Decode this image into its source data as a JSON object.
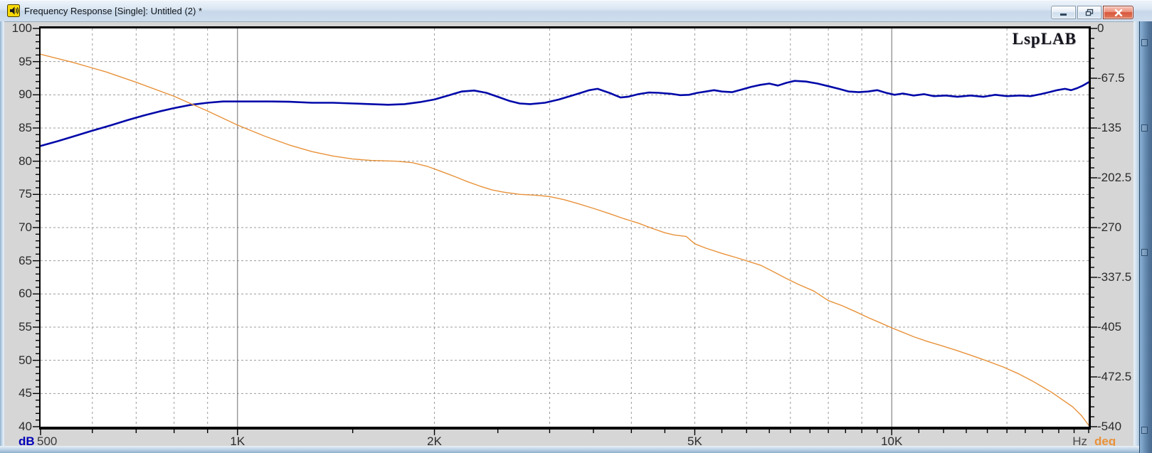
{
  "window": {
    "title": "Frequency Response [Single]: Untitled (2) *",
    "icon": "speaker-icon",
    "buttons": {
      "minimize": "Minimize",
      "restore": "Restore",
      "close": "Close"
    }
  },
  "chart": {
    "brand": "LspLAB",
    "left_axis_unit": "dB",
    "right_axis_unit": "deg",
    "x_axis_unit": "Hz",
    "x_start_label": "500",
    "colors": {
      "spl": "#0008a8",
      "phase": "#e8923a",
      "grid": "#9b9b9b",
      "decade": "#6e6e6e",
      "frame": "#000000"
    }
  },
  "chart_data": {
    "type": "line",
    "title": "Frequency Response",
    "x_axis": {
      "label": "Hz",
      "scale": "log",
      "min": 500,
      "max": 20000,
      "tick_labels": [
        "500",
        "1K",
        "2K",
        "5K",
        "10K"
      ],
      "tick_values": [
        500,
        1000,
        2000,
        5000,
        10000
      ],
      "grid_dashed": [
        600,
        700,
        800,
        900,
        2000,
        3000,
        4000,
        5000,
        6000,
        7000,
        8000,
        9000,
        15000
      ],
      "grid_solid": [
        1000,
        10000
      ],
      "minor_ticks": [
        600,
        700,
        800,
        900,
        1000,
        1500,
        2000,
        2500,
        3000,
        3500,
        4000,
        4500,
        5000,
        5500,
        6000,
        6500,
        7000,
        7500,
        8000,
        8500,
        9000,
        9500,
        10000,
        11000,
        12000,
        13000,
        14000,
        15000,
        16000,
        17000,
        18000,
        19000,
        20000
      ]
    },
    "y_left": {
      "label": "dB",
      "min": 40,
      "max": 100,
      "major_step": 5,
      "minor_step": 1,
      "ticks": [
        100,
        95,
        90,
        85,
        80,
        75,
        70,
        65,
        60,
        55,
        50,
        45,
        40
      ]
    },
    "y_right": {
      "label": "deg",
      "min": -540,
      "max": 0,
      "major_step": 67.5,
      "minor_step": 13.5,
      "tick_labels": [
        "0",
        "-67.5",
        "-135",
        "-202.5",
        "-270",
        "-337.5",
        "-405",
        "-472.5",
        "-540"
      ]
    },
    "grid": true,
    "legend": "none",
    "series": [
      {
        "name": "SPL",
        "unit": "dB",
        "axis": "left",
        "color": "#0008a8",
        "width": 2.6,
        "points": [
          [
            500,
            82.3
          ],
          [
            530,
            83.0
          ],
          [
            560,
            83.7
          ],
          [
            600,
            84.6
          ],
          [
            640,
            85.4
          ],
          [
            680,
            86.2
          ],
          [
            720,
            86.9
          ],
          [
            760,
            87.5
          ],
          [
            800,
            88.0
          ],
          [
            850,
            88.5
          ],
          [
            900,
            88.8
          ],
          [
            950,
            89.0
          ],
          [
            1000,
            89.0
          ],
          [
            1060,
            89.0
          ],
          [
            1120,
            89.0
          ],
          [
            1200,
            88.95
          ],
          [
            1300,
            88.8
          ],
          [
            1400,
            88.8
          ],
          [
            1500,
            88.7
          ],
          [
            1600,
            88.6
          ],
          [
            1700,
            88.5
          ],
          [
            1800,
            88.6
          ],
          [
            1900,
            88.9
          ],
          [
            2000,
            89.3
          ],
          [
            2100,
            89.9
          ],
          [
            2200,
            90.5
          ],
          [
            2300,
            90.65
          ],
          [
            2400,
            90.3
          ],
          [
            2500,
            89.7
          ],
          [
            2600,
            89.1
          ],
          [
            2700,
            88.7
          ],
          [
            2800,
            88.6
          ],
          [
            2950,
            88.8
          ],
          [
            3100,
            89.3
          ],
          [
            3300,
            90.1
          ],
          [
            3450,
            90.7
          ],
          [
            3550,
            90.9
          ],
          [
            3700,
            90.3
          ],
          [
            3850,
            89.6
          ],
          [
            3950,
            89.7
          ],
          [
            4100,
            90.1
          ],
          [
            4250,
            90.35
          ],
          [
            4400,
            90.3
          ],
          [
            4600,
            90.15
          ],
          [
            4750,
            89.95
          ],
          [
            4900,
            90.0
          ],
          [
            5050,
            90.3
          ],
          [
            5200,
            90.5
          ],
          [
            5350,
            90.7
          ],
          [
            5500,
            90.5
          ],
          [
            5700,
            90.4
          ],
          [
            5900,
            90.8
          ],
          [
            6100,
            91.2
          ],
          [
            6300,
            91.5
          ],
          [
            6500,
            91.7
          ],
          [
            6700,
            91.4
          ],
          [
            6900,
            91.8
          ],
          [
            7100,
            92.1
          ],
          [
            7400,
            92.0
          ],
          [
            7700,
            91.7
          ],
          [
            8000,
            91.3
          ],
          [
            8300,
            90.9
          ],
          [
            8600,
            90.5
          ],
          [
            8900,
            90.4
          ],
          [
            9200,
            90.5
          ],
          [
            9500,
            90.7
          ],
          [
            9800,
            90.3
          ],
          [
            10100,
            90.0
          ],
          [
            10400,
            90.2
          ],
          [
            10800,
            89.9
          ],
          [
            11200,
            90.1
          ],
          [
            11600,
            89.8
          ],
          [
            12100,
            89.9
          ],
          [
            12600,
            89.7
          ],
          [
            13200,
            89.9
          ],
          [
            13800,
            89.7
          ],
          [
            14400,
            90.0
          ],
          [
            15000,
            89.8
          ],
          [
            15700,
            89.9
          ],
          [
            16300,
            89.8
          ],
          [
            16900,
            90.1
          ],
          [
            17400,
            90.4
          ],
          [
            17900,
            90.7
          ],
          [
            18400,
            90.9
          ],
          [
            18800,
            90.7
          ],
          [
            19200,
            91.0
          ],
          [
            19600,
            91.4
          ],
          [
            20000,
            91.9
          ]
        ]
      },
      {
        "name": "Phase",
        "unit": "deg",
        "axis": "right",
        "color": "#e8923a",
        "width": 1.4,
        "points": [
          [
            500,
            -35
          ],
          [
            560,
            -46
          ],
          [
            630,
            -59
          ],
          [
            700,
            -73
          ],
          [
            800,
            -92
          ],
          [
            900,
            -112
          ],
          [
            1000,
            -131
          ],
          [
            1100,
            -146
          ],
          [
            1200,
            -158
          ],
          [
            1300,
            -167
          ],
          [
            1400,
            -173
          ],
          [
            1500,
            -177
          ],
          [
            1600,
            -179
          ],
          [
            1750,
            -180
          ],
          [
            1850,
            -182
          ],
          [
            1950,
            -187
          ],
          [
            2050,
            -194
          ],
          [
            2150,
            -201
          ],
          [
            2250,
            -208
          ],
          [
            2350,
            -214
          ],
          [
            2450,
            -219
          ],
          [
            2550,
            -222
          ],
          [
            2700,
            -225
          ],
          [
            2850,
            -226
          ],
          [
            3000,
            -228
          ],
          [
            3150,
            -232
          ],
          [
            3300,
            -237
          ],
          [
            3500,
            -244
          ],
          [
            3700,
            -251
          ],
          [
            3900,
            -258
          ],
          [
            4100,
            -264
          ],
          [
            4300,
            -271
          ],
          [
            4500,
            -277
          ],
          [
            4650,
            -280
          ],
          [
            4850,
            -282
          ],
          [
            5000,
            -292
          ],
          [
            5200,
            -298
          ],
          [
            5500,
            -305
          ],
          [
            5800,
            -311
          ],
          [
            6000,
            -315
          ],
          [
            6300,
            -321
          ],
          [
            6600,
            -330
          ],
          [
            6900,
            -339
          ],
          [
            7200,
            -347
          ],
          [
            7600,
            -356
          ],
          [
            8000,
            -369
          ],
          [
            8400,
            -376
          ],
          [
            8800,
            -384
          ],
          [
            9200,
            -392
          ],
          [
            9600,
            -399
          ],
          [
            10000,
            -406
          ],
          [
            10400,
            -412
          ],
          [
            10800,
            -418
          ],
          [
            11300,
            -424
          ],
          [
            11900,
            -430
          ],
          [
            12500,
            -436
          ],
          [
            13200,
            -443
          ],
          [
            14000,
            -451
          ],
          [
            14800,
            -459
          ],
          [
            15600,
            -468
          ],
          [
            16400,
            -478
          ],
          [
            17000,
            -486
          ],
          [
            17600,
            -494
          ],
          [
            18200,
            -503
          ],
          [
            18900,
            -513
          ],
          [
            19500,
            -525
          ],
          [
            20000,
            -538
          ]
        ]
      }
    ]
  }
}
